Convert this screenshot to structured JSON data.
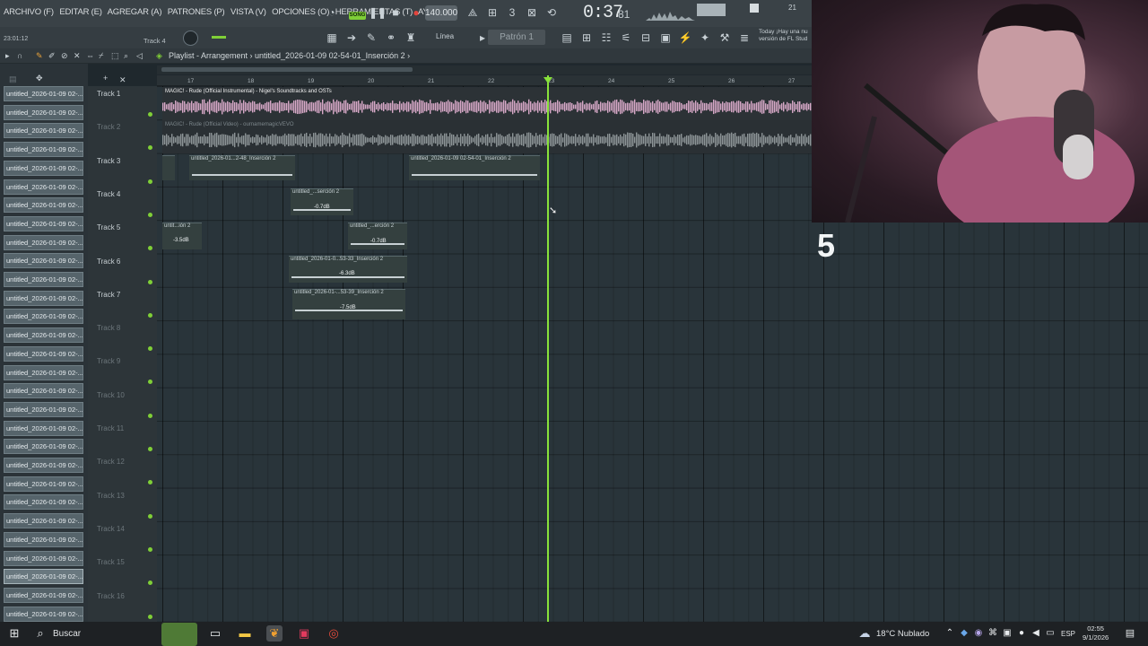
{
  "menu": {
    "items": [
      "ARCHIVO (F)",
      "EDITAR (E)",
      "AGREGAR (A)",
      "PATRONES (P)",
      "VISTA (V)",
      "OPCIONES (O)",
      "HERRAMIENTAS (T)",
      "AYUDA"
    ],
    "song_badge": "SONG",
    "tempo": "140.000",
    "time_main": "0:37",
    "time_frames": "81",
    "cpu_value": "21"
  },
  "toolbar2": {
    "clock": "23:01:12",
    "track_hint": "Track 4",
    "snap_label": "Línea",
    "pattern": "Patrón 1",
    "news_line1": "Today ¡Hay una nu",
    "news_line2": "versión de FL Stud"
  },
  "playlist": {
    "breadcrumb": "Playlist - Arrangement › untitled_2026-01-09 02-54-01_Inserción 2 ›"
  },
  "browser": {
    "item_label": "untitled_2026-01-09 02-...",
    "count": 29,
    "selected_index": 26
  },
  "ruler": [
    "17",
    "18",
    "19",
    "20",
    "21",
    "22",
    "23",
    "24",
    "25",
    "26",
    "27"
  ],
  "tracks": [
    "Track 1",
    "Track 2",
    "Track 3",
    "Track 4",
    "Track 5",
    "Track 6",
    "Track 7",
    "Track 8",
    "Track 9",
    "Track 10",
    "Track 11",
    "Track 12",
    "Track 13",
    "Track 14",
    "Track 15",
    "Track 16"
  ],
  "lanes": {
    "lane1_title": "MAGIC! - Rude (Official Instrumental) - Nigel's Soundtracks and OSTs",
    "lane2_title": "MAGIC! - Rude (Official Video) - ournamemagicVEVO"
  },
  "clips": [
    {
      "title": "untitled_2026-01...2-48_Inserción 2",
      "db": ""
    },
    {
      "title": "untitled_2026-01-09 02-54-01_Inserción 2",
      "db": ""
    },
    {
      "title": "untitled_...serción 2",
      "db": "-0.7dB"
    },
    {
      "title": "untit...ión 2",
      "db": "-3.5dB"
    },
    {
      "title": "untitled_...erción 2",
      "db": "-0.7dB"
    },
    {
      "title": "untitled_2026-01-0...53-33_Inserción 2",
      "db": "-6.3dB"
    },
    {
      "title": "untitled_2026-01-...53-39_Inserción 2",
      "db": "-7.5dB"
    }
  ],
  "overlay": {
    "big_number": "5"
  },
  "taskbar": {
    "search": "Buscar",
    "weather": "18°C  Nublado",
    "language": "ESP",
    "time": "02:55",
    "date": "9/1/2026"
  },
  "colors": {
    "playhead": "#88e23a",
    "accent_green": "#7fcf37",
    "lane1_wave": "#d8a9c8",
    "lane2_wave": "#8d9597"
  }
}
